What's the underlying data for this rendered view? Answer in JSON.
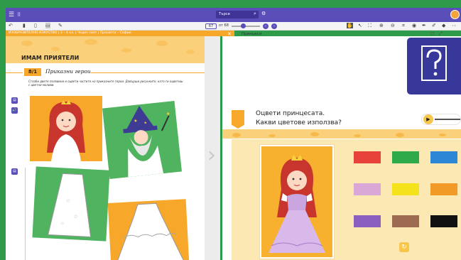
{
  "topbar": {
    "search_placeholder": "Търси",
    "menu_icon": "hamburger-icon",
    "search_icon": "search-icon",
    "settings_icon": "gear-icon"
  },
  "toolbar": {
    "page_current": "67",
    "page_total_label": "от 68",
    "zoom_fraction": 0.4
  },
  "breadcrumb": "ИЗОБРАЗИТЕЛНО ИЗКУСТВО | 3 – 4 кл. | Чедин свят | Просвета – Софии",
  "right_tab": "Принцеси",
  "page": {
    "unit_title": "ИМАМ ПРИЯТЕЛИ",
    "lesson_number": "8/1",
    "lesson_title": "Приказни герои",
    "instructions": "Сглоби двете половини и оцвети частите на приказните герои. Довърши рисунките, като ги оцветиш с цветни моливи."
  },
  "exercise": {
    "question_line1": "Оцвети принцесата.",
    "question_line2": "Какви цветове използва?",
    "swatches": [
      "#e8433a",
      "#2faa4a",
      "#2e86d6",
      "#d9a8d6",
      "#f4e21a",
      "#f19a28",
      "#8a5fc0",
      "#9c6b52",
      "#111111"
    ]
  },
  "colors": {
    "accent": "#5a4fb8",
    "brand_green": "#2e9b4a",
    "orange": "#f7a72a",
    "help_tile": "#38389a"
  }
}
